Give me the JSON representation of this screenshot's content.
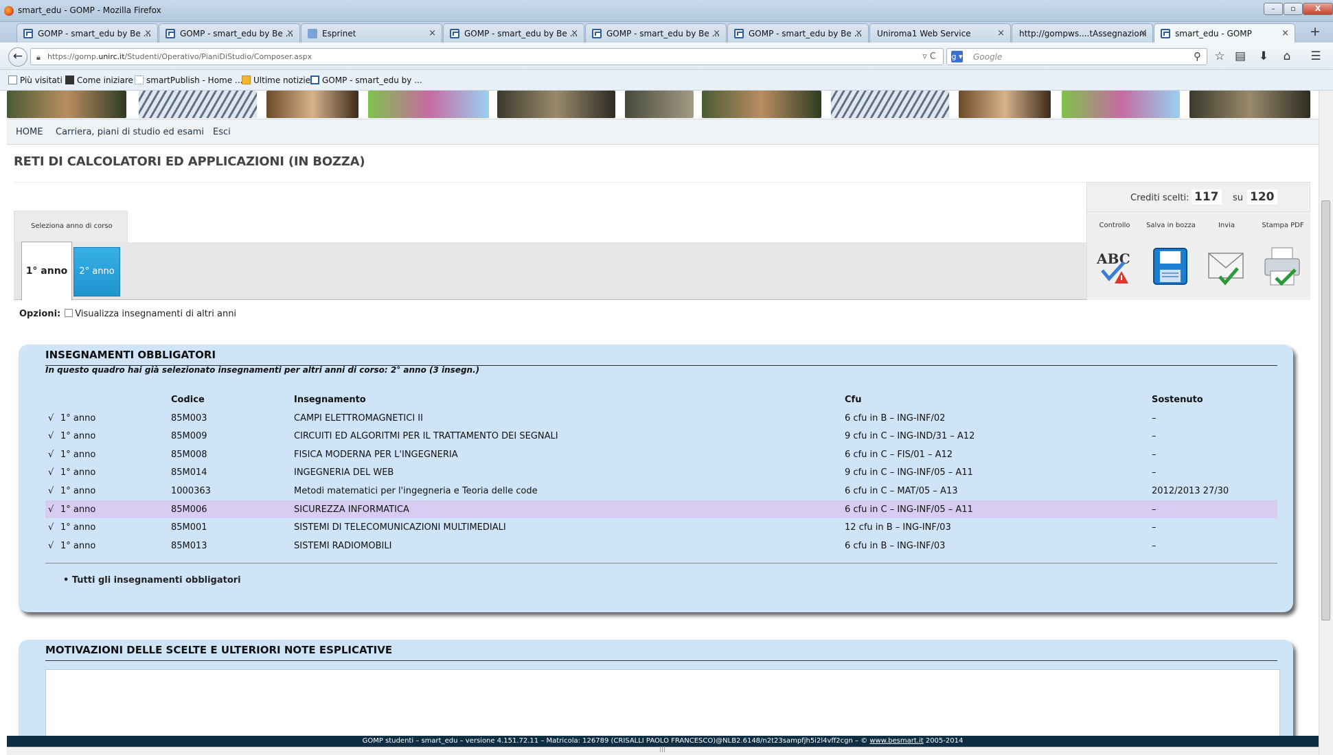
{
  "window": {
    "title": "smart_edu - GOMP - Mozilla Firefox",
    "min": "–",
    "max": "▫",
    "close": "X"
  },
  "tabs": [
    {
      "label": "GOMP - smart_edu by Be ..."
    },
    {
      "label": "GOMP - smart_edu by Be ..."
    },
    {
      "label": "Esprinet"
    },
    {
      "label": "GOMP - smart_edu by Be ..."
    },
    {
      "label": "GOMP - smart_edu by Be ..."
    },
    {
      "label": "GOMP - smart_edu by Be ..."
    },
    {
      "label": "Uniroma1 Web Service"
    },
    {
      "label": "http://gompws....tAssegnazioni"
    },
    {
      "label": "smart_edu - GOMP"
    }
  ],
  "tab_close": "×",
  "new_tab": "+",
  "nav": {
    "back": "←",
    "url_prefix": "https://gomp.",
    "url_domain": "unirc.it",
    "url_path": "/Studenti/Operativo/PianiDiStudio/Composer.aspx",
    "url_controls": "▿ C",
    "search_engine": "g ▾",
    "search_placeholder": "Google",
    "search_icon": "⚲",
    "icons": [
      "☆",
      "▤",
      "⬇",
      "⌂",
      "☰"
    ]
  },
  "bookmarks": [
    {
      "label": "Più visitati"
    },
    {
      "label": "Come iniziare"
    },
    {
      "label": "smartPublish - Home ..."
    },
    {
      "label": "Ultime notizie"
    },
    {
      "label": "GOMP - smart_edu by ..."
    }
  ],
  "menu": [
    {
      "label": "HOME"
    },
    {
      "label": "Carriera, piani di studio ed esami"
    },
    {
      "label": "Esci"
    }
  ],
  "page_title": "RETI DI CALCOLATORI ED APPLICAZIONI (IN BOZZA)",
  "credits": {
    "label": "Crediti scelti:",
    "chosen": "117",
    "sep": "su",
    "total": "120"
  },
  "actions": [
    {
      "label": "Controllo",
      "icon": "abc-check-icon"
    },
    {
      "label": "Salva in bozza",
      "icon": "floppy-save-icon"
    },
    {
      "label": "Invia",
      "icon": "envelope-send-icon"
    },
    {
      "label": "Stampa PDF",
      "icon": "printer-icon"
    }
  ],
  "abc_text": "ABC",
  "select_year_tab": "Seleziona anno di corso",
  "years": [
    "1° anno",
    "2° anno"
  ],
  "options": {
    "label": "Opzioni:",
    "checkbox_label": "Visualizza insegnamenti di altri anni"
  },
  "obbligatori": {
    "title": "INSEGNAMENTI OBBLIGATORI",
    "note": "In questo quadro hai già selezionato insegnamenti per altri anni di corso: 2° anno (3 insegn.)",
    "headers": {
      "codice": "Codice",
      "insegnamento": "Insegnamento",
      "cfu": "Cfu",
      "sostenuto": "Sostenuto"
    },
    "rows": [
      {
        "check": "√",
        "anno": "1° anno",
        "codice": "85M003",
        "insegnamento": "CAMPI ELETTROMAGNETICI II",
        "cfu": "6 cfu in B – ING-INF/02",
        "sostenuto": "–"
      },
      {
        "check": "√",
        "anno": "1° anno",
        "codice": "85M009",
        "insegnamento": "CIRCUITI ED ALGORITMI PER IL TRATTAMENTO DEI SEGNALI",
        "cfu": "9 cfu in C – ING-IND/31 – A12",
        "sostenuto": "–"
      },
      {
        "check": "√",
        "anno": "1° anno",
        "codice": "85M008",
        "insegnamento": "FISICA MODERNA PER L'INGEGNERIA",
        "cfu": "6 cfu in C – FIS/01 – A12",
        "sostenuto": "–"
      },
      {
        "check": "√",
        "anno": "1° anno",
        "codice": "85M014",
        "insegnamento": "INGEGNERIA DEL WEB",
        "cfu": "9 cfu in C – ING-INF/05 – A11",
        "sostenuto": "–"
      },
      {
        "check": "√",
        "anno": "1° anno",
        "codice": "1000363",
        "insegnamento": "Metodi matematici per l'ingegneria e Teoria delle code",
        "cfu": "6 cfu in C – MAT/05 – A13",
        "sostenuto": "2012/2013 27/30"
      },
      {
        "check": "√",
        "anno": "1° anno",
        "codice": "85M006",
        "insegnamento": "SICUREZZA INFORMATICA",
        "cfu": "6 cfu in C – ING-INF/05 – A11",
        "sostenuto": "–"
      },
      {
        "check": "√",
        "anno": "1° anno",
        "codice": "85M001",
        "insegnamento": "SISTEMI DI TELECOMUNICAZIONI MULTIMEDIALI",
        "cfu": "12 cfu in B – ING-INF/03",
        "sostenuto": "–"
      },
      {
        "check": "√",
        "anno": "1° anno",
        "codice": "85M013",
        "insegnamento": "SISTEMI RADIOMOBILI",
        "cfu": "6 cfu in B – ING-INF/03",
        "sostenuto": "–"
      }
    ],
    "footer_link": "• Tutti gli insegnamenti obbligatori"
  },
  "motivazioni": {
    "title": "MOTIVAZIONI DELLE SCELTE E ULTERIORI NOTE ESPLICATIVE",
    "value": ""
  },
  "status": {
    "text": "GOMP studenti – smart_edu – versione 4.151.72.11 – Matricola: 126789 (CRISALLI PAOLO FRANCESCO)@NLB2.6148/n2t23sampfjh5i2l4vff2cgn – © ",
    "link": "www.besmart.it",
    "suffix": " 2005-2014"
  },
  "hscroll_grip": "|||"
}
